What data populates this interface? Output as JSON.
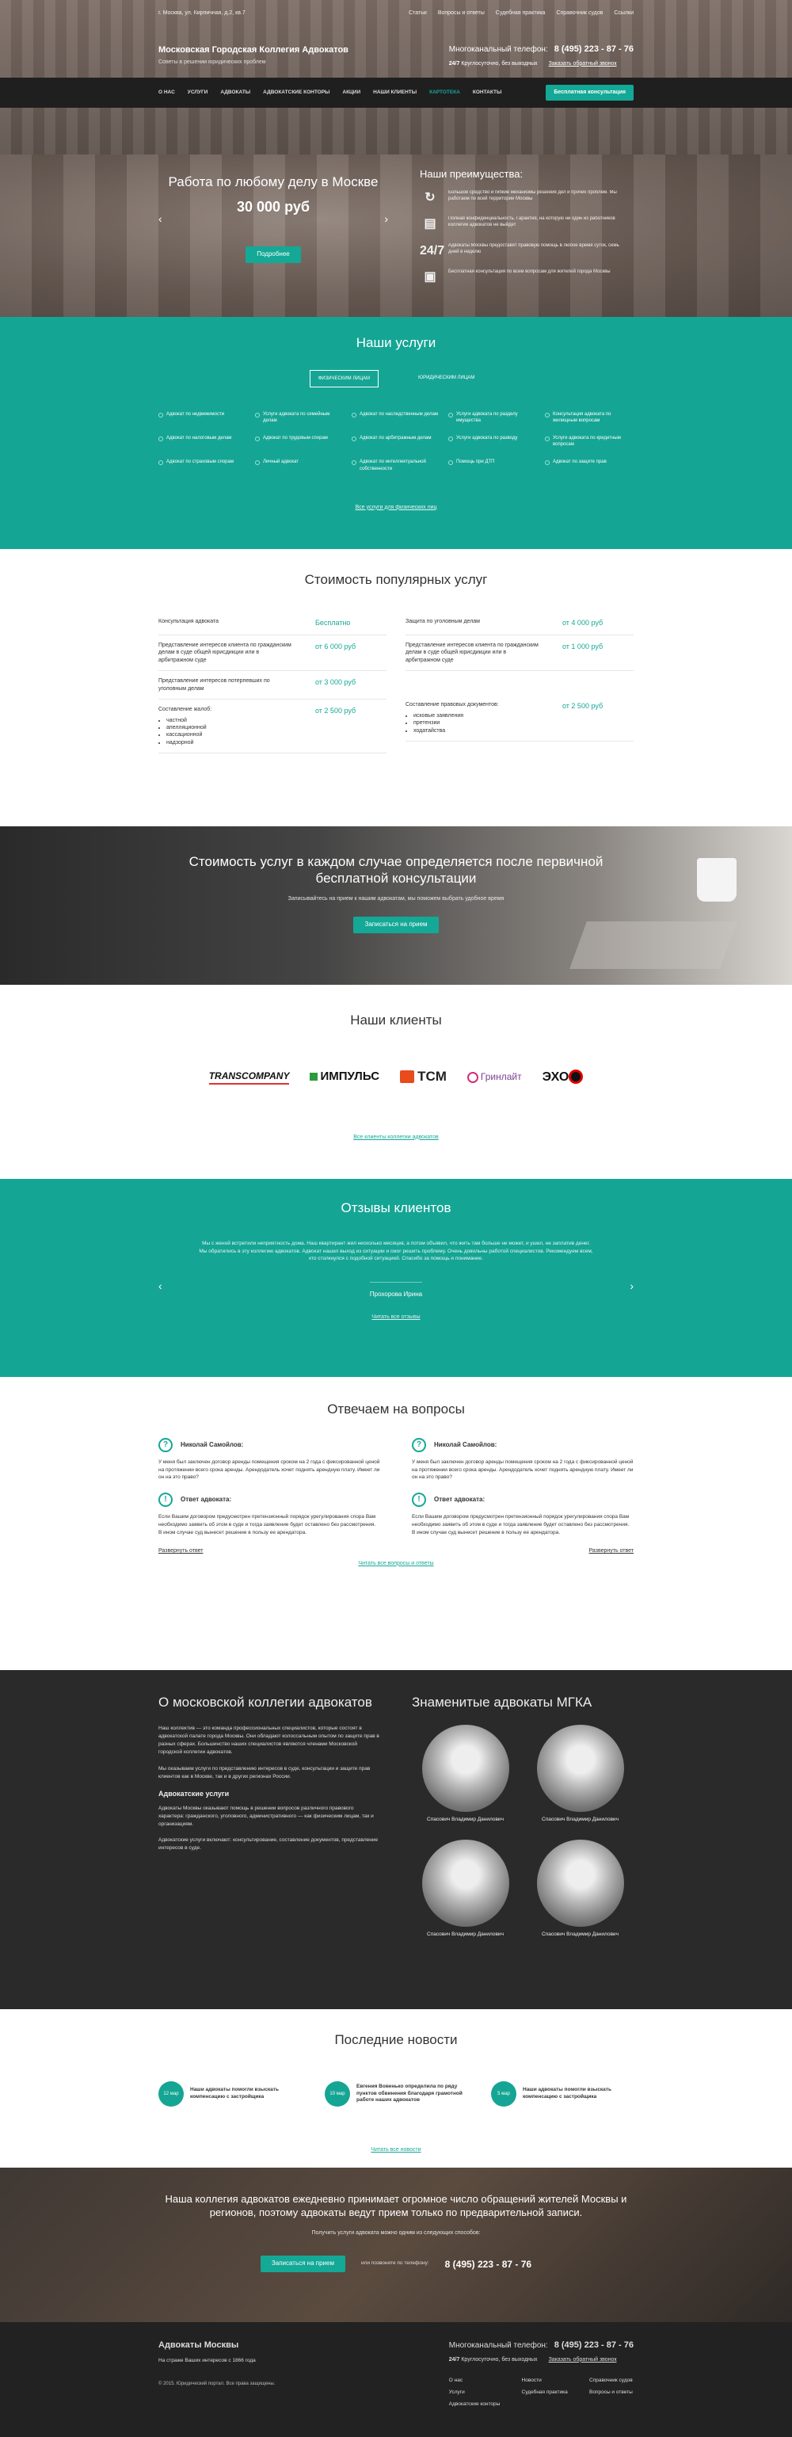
{
  "topbar": {
    "address": "г. Москва, ул. Кирпичная, д.2, кв.7",
    "links": [
      "Статьи",
      "Вопросы и ответы",
      "Судебная практика",
      "Справочник судов",
      "Ссылки"
    ]
  },
  "brand": {
    "title": "Московская Городская Коллегия Адвокатов",
    "subtitle": "Советы в решении юридических проблем"
  },
  "phone": {
    "label": "Многоканальный телефон:",
    "number": "8 (495) 223 - 87 - 76",
    "h24": "24/7",
    "h24_text": "Круглосуточно, без выходных",
    "callback": "Заказать обратный звонок"
  },
  "nav": {
    "items": [
      "О НАС",
      "УСЛУГИ",
      "АДВОКАТЫ",
      "АДВОКАТСКИЕ КОНТОРЫ",
      "АКЦИИ",
      "НАШИ КЛИЕНТЫ",
      "КАРТОТЕКА",
      "КОНТАКТЫ"
    ],
    "active_index": 6,
    "consult_btn": "Бесплатная консультация"
  },
  "hero": {
    "title": "Работа по любому делу в Москве",
    "price": "30 000 руб",
    "btn": "Подробнее",
    "adv_title": "Наши преимущества:",
    "adv": [
      {
        "icon": "↻",
        "text": "Большое средство и гибкие механизмы решения дел и прочих проблем. Мы работаем по всей территории Москвы"
      },
      {
        "icon": "▤",
        "text": "Полная конфиденциальность. Гарантия, на которую ни один из работников коллегии адвокатов не выйдет"
      },
      {
        "icon": "24/7",
        "text": "Адвокаты Москвы предоставят правовую помощь в любое время суток, семь дней в неделю"
      },
      {
        "icon": "▣",
        "text": "Бесплатная консультация по всем вопросам для жителей города Москвы"
      }
    ]
  },
  "services": {
    "title": "Наши услуги",
    "tabs": [
      "ФИЗИЧЕСКИМ ЛИЦАМ",
      "ЮРИДИЧЕСКИМ ЛИЦАМ"
    ],
    "items": [
      "Адвокат по недвижимости",
      "Услуги адвоката по семейным делам",
      "Адвокат по наследственным делам",
      "Услуги адвоката по разделу имущества",
      "Консультация адвоката по жилищным вопросам",
      "Адвокат по налоговым делам",
      "Адвокат по трудовым спорам",
      "Адвокат по арбитражным делам",
      "Услуги адвоката по разводу",
      "Услуги адвоката по кредитным вопросам",
      "Адвокат по страховым спорам",
      "Личный адвокат",
      "Адвокат по интеллектуальной собственности",
      "Помощь при ДТП",
      "Адвокат по защите прав"
    ],
    "all": "Все услуги для физических лиц"
  },
  "prices": {
    "title": "Стоимость популярных услуг",
    "left": [
      {
        "name": "Консультация адвоката",
        "value": "Бесплатно"
      },
      {
        "name": "Представление интересов клиента по гражданским делам в суде общей юрисдикции или в арбитражном суде",
        "value": "от 6 000 руб"
      },
      {
        "name": "Представление интересов потерпевших по уголовным делам",
        "value": "от 3 000 руб"
      },
      {
        "name": "Составление жалоб:",
        "value": "от 2 500 руб",
        "list": [
          "частной",
          "апелляционной",
          "кассационной",
          "надзорной"
        ]
      }
    ],
    "right": [
      {
        "name": "Защита по уголовным делам",
        "value": "от 4 000 руб"
      },
      {
        "name": "Представление интересов клиента по гражданским делам в суде общей юрисдикции или в арбитражном суде",
        "value": "от 1 000 руб"
      },
      {
        "name": "Составление правовых документов:",
        "value": "от 2 500 руб",
        "list": [
          "исковые заявления",
          "претензии",
          "ходатайства"
        ]
      }
    ]
  },
  "consult": {
    "title": "Стоимость услуг в каждом случае определяется после первичной бесплатной консультации",
    "text": "Записывайтесь на прием к нашим адвокатам, мы поможем выбрать удобное время",
    "btn": "Записаться на прием"
  },
  "clients": {
    "title": "Наши клиенты",
    "logos": [
      "TRANSCOMPANY",
      "ИМПУЛЬС",
      "TCM",
      "Гринлайт",
      "ЭХО"
    ],
    "all": "Все клиенты коллегии адвокатов"
  },
  "reviews": {
    "title": "Отзывы клиентов",
    "text": "Мы с женой встретили неприятность дома. Наш квартирант жил несколько месяцев, а потом объявил, что жить там больше не может, и ушел, не заплатив денег. Мы обратились в эту коллегию адвокатов. Адвокат нашел выход из ситуации и смог решить проблему. Очень довольны работой специалистов. Рекомендуем всем, кто столкнулся с подобной ситуацией. Спасибо за помощь и понимание.",
    "author": "Прохорова Ирина",
    "all": "Читать все отзывы"
  },
  "qa": {
    "title": "Отвечаем на вопросы",
    "items": [
      {
        "name": "Николай Самойлов:",
        "question": "У меня был заключен договор аренды помещения сроком на 2 года с фиксированной ценой на протяжении всего срока аренды. Арендодатель хочет поднять арендную плату. Имеет ли он на это право?",
        "answer_label": "Ответ адвоката:",
        "answer": "Если Вашим договором предусмотрен претензионный порядок урегулирования спора Вам необходимо заявить об этом в суде и тогда заявление будет оставлено без рассмотрения. В ином случае суд вынесет решение в пользу ее арендатора.",
        "expand": "Развернуть ответ"
      },
      {
        "name": "Николай Самойлов:",
        "question": "У меня был заключен договор аренды помещения сроком на 2 года с фиксированной ценой на протяжении всего срока аренды. Арендодатель хочет поднять арендную плату. Имеет ли он на это право?",
        "answer_label": "Ответ адвоката:",
        "answer": "Если Вашим договором предусмотрен претензионный порядок урегулирования спора Вам необходимо заявить об этом в суде и тогда заявление будет оставлено без рассмотрения. В ином случае суд вынесет решение в пользу ее арендатора.",
        "expand": "Развернуть ответ"
      }
    ],
    "all": "Читать все вопросы и ответы"
  },
  "about": {
    "title": "О московской коллегии адвокатов",
    "p1": "Наш коллектив — это команда профессиональных специалистов, которые состоят в адвокатской палате города Москвы. Они обладают колоссальным опытом по защите прав в разных сферах. Большинство наших специалистов являются членами Московской городской коллегии адвокатов.",
    "p2": "Мы оказываем услуги по представлению интересов в суде, консультации и защите прав клиентов как в Москве, так и в других регионах России.",
    "h": "Адвокатские услуги",
    "p3": "Адвокаты Москвы оказывают помощь в решении вопросов различного правового характера: гражданского, уголовного, административного — как физическим лицам, так и организациям.",
    "p4": "Адвокатские услуги включают: консультирование, составление документов, представление интересов в суде.",
    "lawyers_title": "Знаменитые адвокаты МГКА",
    "lawyer_name": "Спасович Владимир Данилович"
  },
  "news": {
    "title": "Последние новости",
    "items": [
      {
        "date": "12 мар",
        "title": "Наши адвокаты помогли взыскать компенсацию с застройщика"
      },
      {
        "date": "10 мар",
        "title": "Евгения Вовенько определила по ряду пунктов обвинения благодаря грамотной работе наших адвокатов"
      },
      {
        "date": "5 мар",
        "title": "Наши адвокаты помогли взыскать компенсацию с застройщика"
      }
    ],
    "all": "Читать все новости"
  },
  "cta": {
    "title": "Наша коллегия адвокатов ежедневно принимает огромное число обращений жителей Москвы и регионов, поэтому адвокаты ведут прием только по предварительной записи.",
    "text": "Получить услуги адвоката можно одним из следующих способов:",
    "btn": "Записаться на прием",
    "or": "или позвоните по телефону:",
    "phone": "8 (495) 223 - 87 - 76"
  },
  "footer": {
    "title": "Адвокаты Москвы",
    "sub": "На страже Ваших интересов с 1866 года",
    "copy": "© 2015. Юридический портал. Все права защищены.",
    "phone_label": "Многоканальный телефон:",
    "phone": "8 (495) 223 - 87 - 76",
    "h24": "24/7",
    "h24_text": "Круглосуточно, без выходных",
    "callback": "Заказать обратный звонок",
    "links": [
      "О нас",
      "Новости",
      "Справочник судов",
      "Услуги",
      "Судебная практика",
      "Вопросы и ответы",
      "Адвокатские конторы"
    ]
  }
}
